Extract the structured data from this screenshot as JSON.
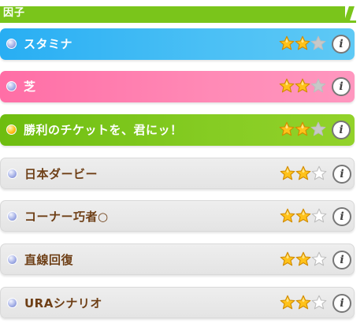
{
  "header": {
    "title": "因子"
  },
  "factors": [
    {
      "label": "スタミナ",
      "style": "blue",
      "dot": "silver",
      "stars": 2,
      "max_stars": 3,
      "info_icon": "i"
    },
    {
      "label": "芝",
      "style": "pink",
      "dot": "silver",
      "stars": 2,
      "max_stars": 3,
      "info_icon": "i"
    },
    {
      "label": "勝利のチケットを、君にッ！",
      "style": "green",
      "dot": "gold",
      "stars": 2,
      "max_stars": 3,
      "info_icon": "i"
    },
    {
      "label": "日本ダービー",
      "style": "gray",
      "dot": "silver",
      "stars": 2,
      "max_stars": 3,
      "info_icon": "i"
    },
    {
      "label": "コーナー巧者○",
      "style": "gray",
      "dot": "silver",
      "stars": 2,
      "max_stars": 3,
      "info_icon": "i"
    },
    {
      "label": "直線回復",
      "style": "gray",
      "dot": "silver",
      "stars": 2,
      "max_stars": 3,
      "info_icon": "i"
    },
    {
      "label": "URAシナリオ",
      "style": "gray",
      "dot": "silver",
      "stars": 2,
      "max_stars": 3,
      "info_icon": "i"
    }
  ],
  "colors": {
    "blue": "#28aef3",
    "pink": "#ff6ea6",
    "green": "#7ac51b",
    "gray": "#e8e8e8",
    "star_filled": "#ffc21a",
    "star_empty_on_color": "#c8c8c8",
    "star_empty_on_gray": "#ffffff",
    "text_dark": "#6e3f16"
  }
}
